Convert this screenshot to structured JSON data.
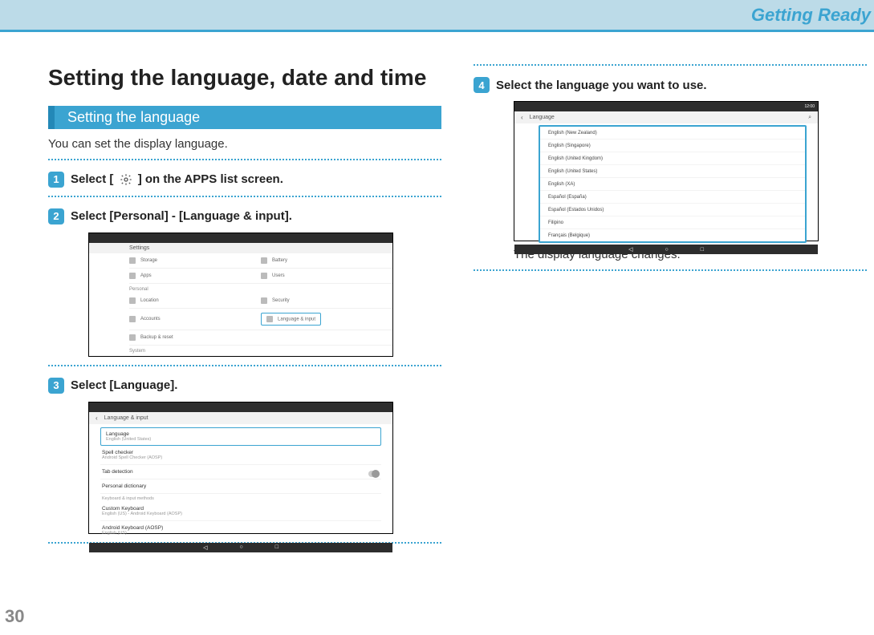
{
  "header": {
    "title": "Getting Ready"
  },
  "page_number": "30",
  "left": {
    "section_title": "Setting the language, date and time",
    "sub_header": "Setting the language",
    "intro": "You can set the display language.",
    "step1": {
      "num": "1",
      "pre": "Select [",
      "post": "] on the APPS list screen."
    },
    "step2": {
      "num": "2",
      "text": "Select [Personal] - [Language & input].",
      "screenshot": {
        "title": "Settings",
        "rows": {
          "storage": "Storage",
          "battery": "Battery",
          "apps": "Apps",
          "users": "Users"
        },
        "cat_personal": "Personal",
        "personal_rows": {
          "location": "Location",
          "security": "Security",
          "accounts": "Accounts",
          "lang_input": "Language & input",
          "backup": "Backup & reset"
        },
        "cat_system": "System"
      }
    },
    "step3": {
      "num": "3",
      "text": "Select [Language].",
      "screenshot": {
        "title": "Language & input",
        "items": {
          "language": {
            "t": "Language",
            "s": "English (United States)"
          },
          "spell": {
            "t": "Spell checker",
            "s": "Android Spell Checker (AOSP)"
          },
          "tab": {
            "t": "Tab detection"
          },
          "dict": {
            "t": "Personal dictionary"
          },
          "heading_kbd": "Keyboard & input methods",
          "custom": {
            "t": "Custom Keyboard",
            "s": "English (US) - Android Keyboard (AOSP)"
          },
          "aosp": {
            "t": "Android Keyboard (AOSP)",
            "s": "English (US)"
          }
        }
      }
    }
  },
  "right": {
    "step4": {
      "num": "4",
      "text": "Select the language you want to use.",
      "screenshot": {
        "title": "Language",
        "time": "12:00",
        "items": [
          "English (New Zealand)",
          "English (Singapore)",
          "English (United Kingdom)",
          "English (United States)",
          "English (XA)",
          "Español (España)",
          "Español (Estados Unidos)",
          "Filipino",
          "Français (Belgique)"
        ]
      },
      "caption": "The display language changes."
    }
  }
}
